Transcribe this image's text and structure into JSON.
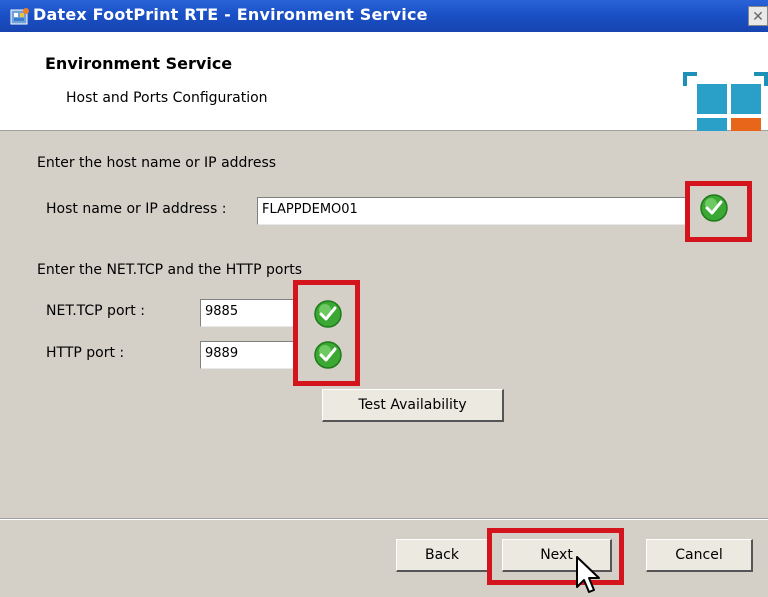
{
  "window": {
    "title": "Datex FootPrint RTE - Environment Service",
    "close_glyph": "✕"
  },
  "header": {
    "title": "Environment Service",
    "subtitle": "Host and Ports Configuration"
  },
  "host_section": {
    "instruction": "Enter the host name or IP address",
    "label": "Host name or IP address :",
    "value": "FLAPPDEMO01",
    "status_icon": "green-check-icon"
  },
  "ports_section": {
    "instruction": "Enter the NET.TCP and the HTTP ports",
    "nettcp_label": "NET.TCP port :",
    "nettcp_value": "9885",
    "http_label": "HTTP port :",
    "http_value": "9889",
    "test_button": "Test Availability"
  },
  "footer": {
    "back": "Back",
    "next": "Next",
    "cancel": "Cancel"
  },
  "colors": {
    "titlebar": "#1a4fc4",
    "highlight": "#d4141c",
    "check": "#3aa832"
  }
}
